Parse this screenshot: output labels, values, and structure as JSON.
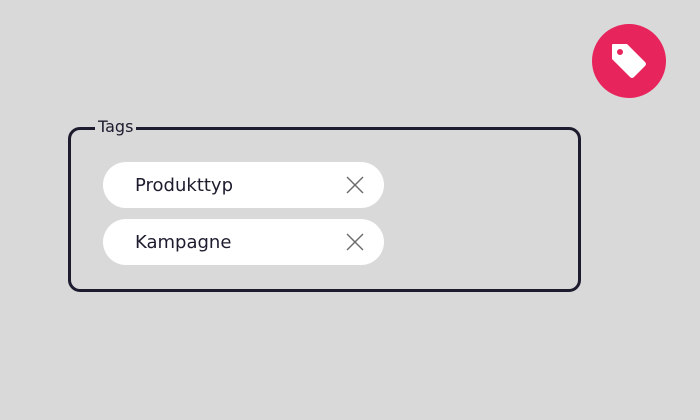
{
  "badge": {
    "icon": "tag-icon",
    "color": "#e8245c"
  },
  "tags_field": {
    "legend": "Tags",
    "border_color": "#1c1c2e",
    "chips": [
      {
        "label": "Produkttyp",
        "remove_icon": "close-icon"
      },
      {
        "label": "Kampagne",
        "remove_icon": "close-icon"
      }
    ]
  }
}
